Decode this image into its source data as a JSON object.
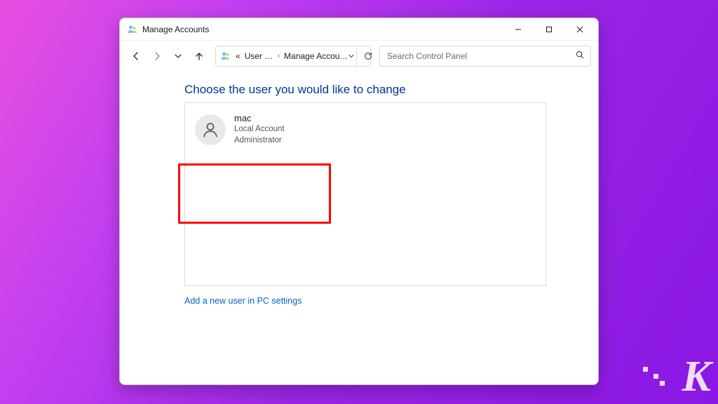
{
  "window": {
    "title": "Manage Accounts"
  },
  "address": {
    "seg1": "«",
    "seg2": "User …",
    "seg3": "Manage Accou…"
  },
  "search": {
    "placeholder": "Search Control Panel"
  },
  "page": {
    "heading": "Choose the user you would like to change",
    "link": "Add a new user in PC settings"
  },
  "user": {
    "name": "mac",
    "line1": "Local Account",
    "line2": "Administrator"
  },
  "branding": {
    "logo": "K"
  }
}
